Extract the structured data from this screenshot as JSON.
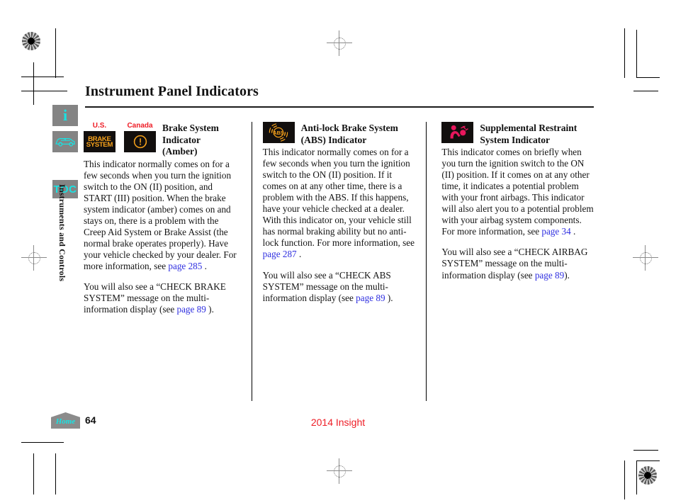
{
  "document": {
    "heading": "Instrument Panel Indicators",
    "page_number": "64",
    "model_line": "2014 Insight",
    "section_tab": "Instruments and Controls"
  },
  "sidebar": {
    "items": [
      {
        "name": "info",
        "label": "i",
        "icon": "info-icon"
      },
      {
        "name": "vehicle",
        "label": "",
        "icon": "car-icon"
      },
      {
        "name": "toc",
        "label": "TOC",
        "icon": "toc-icon"
      }
    ]
  },
  "footer": {
    "home_label": "Home"
  },
  "columns": [
    {
      "id": "brake-system",
      "title": "Brake System\nIndicator\n(Amber)",
      "title_lines": [
        "Brake System",
        "Indicator",
        "(Amber)"
      ],
      "icons": [
        {
          "locale": "U.S.",
          "glyph": "brake-system-text",
          "glyph_text_lines": [
            "BRAKE",
            "SYSTEM"
          ],
          "color": "#f5a11b"
        },
        {
          "locale": "Canada",
          "glyph": "circle-exclamation",
          "color": "#f5a11b"
        }
      ],
      "paragraphs": [
        {
          "runs": [
            {
              "t": "This indicator normally comes on for a few seconds when you turn the ignition switch to the ON (II) position, and START (III) position. When the brake system indicator (amber) comes on and stays on, there is a problem with the Creep Aid System or Brake Assist (the normal brake operates properly). Have your vehicle checked by your dealer. For more information, see "
            },
            {
              "t": "page 285",
              "link": true
            },
            {
              "t": " ."
            }
          ]
        },
        {
          "runs": [
            {
              "t": "You will also see a “CHECK BRAKE SYSTEM” message on the multi-information display (see "
            },
            {
              "t": "page  89",
              "link": true
            },
            {
              "t": "  )."
            }
          ]
        }
      ]
    },
    {
      "id": "abs",
      "title_lines": [
        "Anti-lock Brake System",
        "(ABS) Indicator"
      ],
      "icons": [
        {
          "locale": "",
          "glyph": "abs-indicator",
          "color": "#f5a11b"
        }
      ],
      "paragraphs": [
        {
          "runs": [
            {
              "t": "This indicator normally comes on for a few seconds when you turn the ignition switch to the ON (II) position. If it comes on at any other time, there is a problem with the ABS. If this happens, have your vehicle checked at a dealer. With this indicator on, your vehicle still has normal braking ability but no anti-lock function. For more information, see "
            },
            {
              "t": "page 287",
              "link": true
            },
            {
              "t": " ."
            }
          ]
        },
        {
          "runs": [
            {
              "t": "You will also see a “CHECK ABS SYSTEM” message on the multi-information display (see "
            },
            {
              "t": "page  89",
              "link": true
            },
            {
              "t": "  )."
            }
          ]
        }
      ]
    },
    {
      "id": "srs",
      "title_lines": [
        "Supplemental Restraint",
        "System Indicator"
      ],
      "icons": [
        {
          "locale": "",
          "glyph": "srs-airbag",
          "color": "#e8175d"
        }
      ],
      "paragraphs": [
        {
          "runs": [
            {
              "t": "This indicator comes on briefly when you turn the ignition switch to the ON (II) position. If it comes on at any other time, it indicates a potential problem with your front airbags. This indicator will also alert you to a potential problem with your airbag system components. For more information, see "
            },
            {
              "t": "page 34",
              "link": true
            },
            {
              "t": " ."
            }
          ]
        },
        {
          "runs": [
            {
              "t": "You will also see a “CHECK AIRBAG SYSTEM” message on the multi-information display (see "
            },
            {
              "t": "page 89",
              "link": true
            },
            {
              "t": ")."
            }
          ]
        }
      ]
    }
  ],
  "colors": {
    "link": "#2f2fe0",
    "locale_label": "#ee1c25",
    "model_line": "#ee1c25",
    "amber": "#f5a11b",
    "srs_red": "#e8175d",
    "nav_gray": "#848484",
    "nav_glyph": "#19e3e3"
  }
}
